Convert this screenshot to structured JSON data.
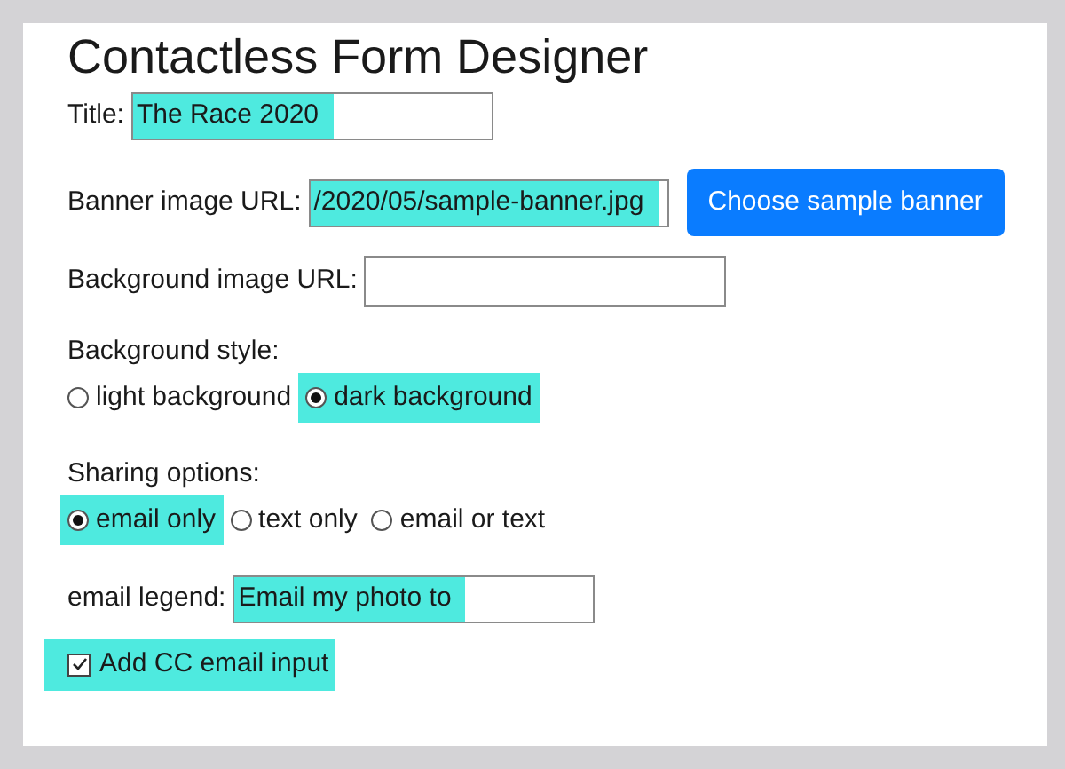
{
  "heading": "Contactless Form Designer",
  "title_field": {
    "label": "Title:",
    "value": "The Race 2020",
    "highlighted": true
  },
  "banner_field": {
    "label": "Banner image URL:",
    "value": "/2020/05/sample-banner.jpg",
    "highlighted": true,
    "button": "Choose sample banner"
  },
  "background_field": {
    "label": "Background image URL:",
    "highlighted": false
  },
  "background_style": {
    "label": "Background style:",
    "options": [
      {
        "label": "light background",
        "selected": false,
        "highlighted": false
      },
      {
        "label": "dark background",
        "selected": true,
        "highlighted": true
      }
    ]
  },
  "sharing_options": {
    "label": "Sharing options:",
    "options": [
      {
        "label": "email only",
        "selected": true,
        "highlighted": true
      },
      {
        "label": "text only",
        "selected": false,
        "highlighted": false
      },
      {
        "label": "email or text",
        "selected": false,
        "highlighted": false
      }
    ]
  },
  "email_legend": {
    "label": "email legend:",
    "value": "Email my photo to",
    "highlighted": true
  },
  "cc_checkbox": {
    "label": "Add CC email input",
    "checked": true,
    "highlighted": true
  }
}
